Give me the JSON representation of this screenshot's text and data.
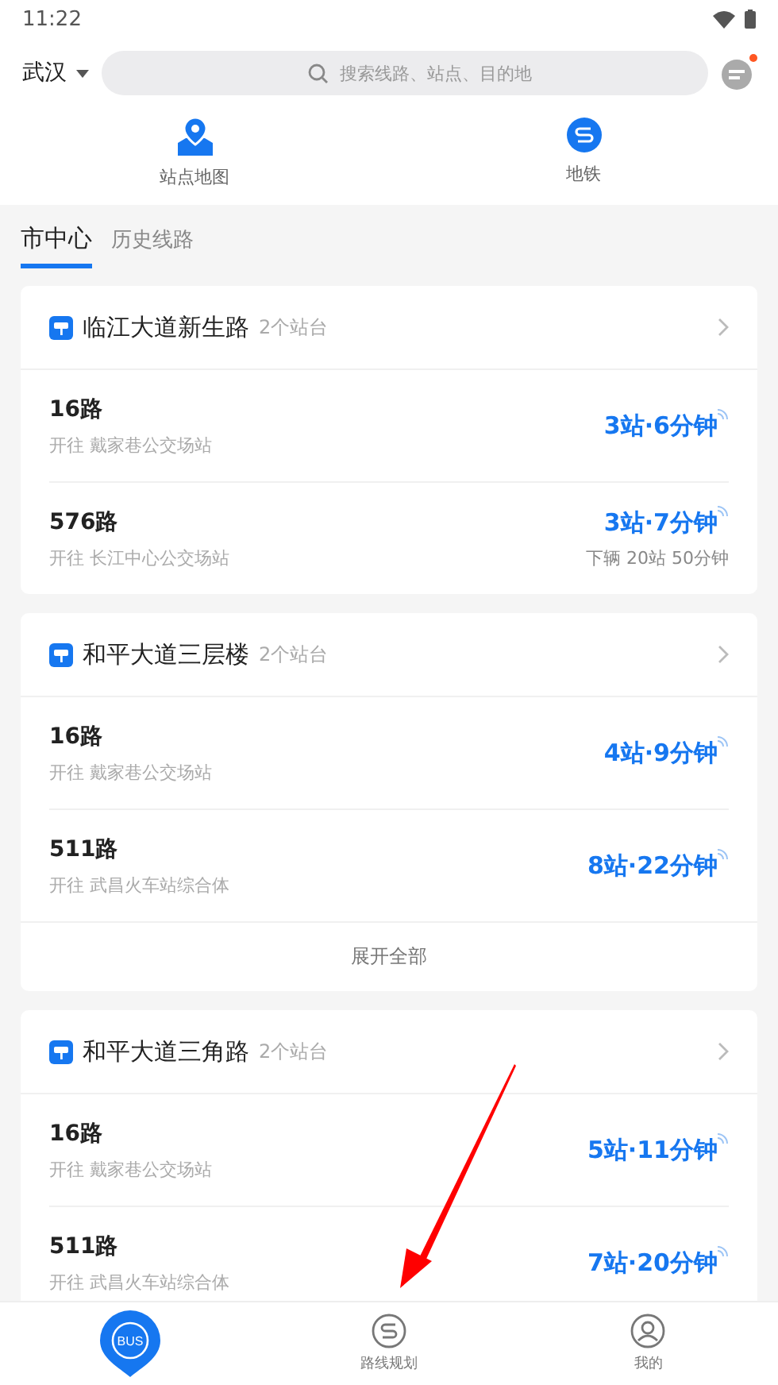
{
  "status_bar": {
    "time": "11:22"
  },
  "header": {
    "city": "武汉",
    "search": {
      "placeholder": "搜索线路、站点、目的地"
    },
    "has_notification": true
  },
  "shortcuts": [
    {
      "kind": "map",
      "label": "站点地图"
    },
    {
      "kind": "metro",
      "label": "地铁"
    }
  ],
  "tabs": [
    {
      "label": "市中心",
      "selected": true
    },
    {
      "label": "历史线路",
      "selected": false
    }
  ],
  "stations": [
    {
      "name": "临江大道新生路",
      "count": "2个站台",
      "routes": [
        {
          "name": "16路",
          "destination": "开往 戴家巷公交场站",
          "eta": "3站·6分钟"
        },
        {
          "name": "576路",
          "destination": "开往 长江中心公交场站",
          "eta": "3站·7分钟",
          "next": "下辆 20站 50分钟"
        }
      ]
    },
    {
      "name": "和平大道三层楼",
      "count": "2个站台",
      "routes": [
        {
          "name": "16路",
          "destination": "开往 戴家巷公交场站",
          "eta": "4站·9分钟"
        },
        {
          "name": "511路",
          "destination": "开往 武昌火车站综合体",
          "eta": "8站·22分钟"
        }
      ],
      "footer": "展开全部"
    },
    {
      "name": "和平大道三角路",
      "count": "2个站台",
      "routes": [
        {
          "name": "16路",
          "destination": "开往 戴家巷公交场站",
          "eta": "5站·11分钟"
        },
        {
          "name": "511路",
          "destination": "开往 武昌火车站综合体",
          "eta": "7站·20分钟"
        }
      ]
    }
  ],
  "bottom_nav": [
    {
      "kind": "bus",
      "label": "BUS",
      "selected": true
    },
    {
      "kind": "route",
      "label": "路线规划",
      "selected": false
    },
    {
      "kind": "profile",
      "label": "我的",
      "selected": false
    }
  ]
}
